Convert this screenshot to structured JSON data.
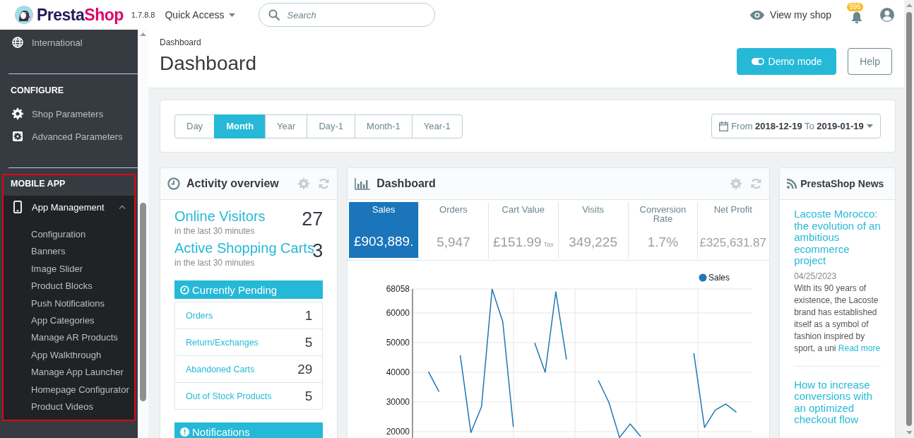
{
  "header": {
    "brand": {
      "first": "Presta",
      "second": "Shop"
    },
    "version": "1.7.8.8",
    "quick_access": "Quick Access",
    "search": {
      "placeholder": "Search"
    },
    "view_shop": "View my shop",
    "notification_count": "996"
  },
  "sidebar": {
    "groups": [
      {
        "items": [
          {
            "label": "International",
            "selected": false
          }
        ]
      },
      {
        "heading": "CONFIGURE",
        "items": [
          {
            "label": "Shop Parameters",
            "selected": false
          },
          {
            "label": "Advanced Parameters",
            "selected": false
          }
        ]
      },
      {
        "heading": "MOBILE APP",
        "highlighted": true,
        "items": [
          {
            "label": "App Management",
            "selected": true,
            "expanded": true,
            "children": [
              {
                "label": "Configuration",
                "selected": false
              },
              {
                "label": "Banners",
                "selected": false
              },
              {
                "label": "Image Slider",
                "selected": false
              },
              {
                "label": "Product Blocks",
                "selected": false
              },
              {
                "label": "Push Notifications",
                "selected": false
              },
              {
                "label": "App Categories",
                "selected": false
              },
              {
                "label": "Manage AR Products",
                "selected": false
              },
              {
                "label": "App Walkthrough",
                "selected": false
              },
              {
                "label": "Manage App Launcher",
                "selected": false
              },
              {
                "label": "Homepage Configurator",
                "selected": false
              },
              {
                "label": "Product Videos",
                "selected": false
              }
            ]
          }
        ]
      }
    ]
  },
  "page": {
    "breadcrumb": "Dashboard",
    "title": "Dashboard",
    "buttons": [
      {
        "kind": "demo",
        "label": "Demo mode"
      },
      {
        "kind": "outline",
        "label": "Help"
      }
    ]
  },
  "period_tabs": [
    {
      "label": "Day",
      "selected": false
    },
    {
      "label": "Month",
      "selected": true
    },
    {
      "label": "Year",
      "selected": false
    },
    {
      "label": "Day-1",
      "selected": false
    },
    {
      "label": "Month-1",
      "selected": false
    },
    {
      "label": "Year-1",
      "selected": false
    }
  ],
  "date_range": "From **2018-12-19** To **2019-01-19**",
  "activity": {
    "title": "Activity overview",
    "stats": [
      {
        "label": "Online Visitors",
        "subtitle": "in the last 30 minutes",
        "value": "27"
      },
      {
        "label": "Active Shopping Carts",
        "subtitle": "in the last 30 minutes",
        "value": "3"
      }
    ],
    "pending_heading": "Currently Pending",
    "pending": [
      {
        "label": "Orders",
        "value": "1"
      },
      {
        "label": "Return/Exchanges",
        "value": "5"
      },
      {
        "label": "Abandoned Carts",
        "value": "29"
      },
      {
        "label": "Out of Stock Products",
        "value": "5"
      }
    ],
    "notifications_heading": "Notifications"
  },
  "dashboard": {
    "title": "Dashboard",
    "kpis": [
      {
        "label": "Sales",
        "value": "£903,889.",
        "selected": true
      },
      {
        "label": "Orders",
        "value": "5,947",
        "selected": false
      },
      {
        "label": "Cart Value",
        "value": "£151.99",
        "suffix": "Tax",
        "selected": false
      },
      {
        "label": "Visits",
        "value": "349,225",
        "selected": false
      },
      {
        "label": "Conversion Rate",
        "value": "1.7%",
        "selected": false
      },
      {
        "label": "Net Profit",
        "value": "£325,631.87",
        "selected": false
      }
    ],
    "chart_data": {
      "type": "line",
      "grid": true,
      "categories": [
        null,
        null,
        null,
        null,
        null,
        null,
        null,
        null,
        null,
        null,
        null,
        null,
        null,
        null,
        null,
        null,
        null,
        null,
        null,
        null,
        null,
        null,
        null,
        null,
        null,
        null,
        null,
        null,
        null,
        null,
        null,
        null
      ],
      "ylim": [
        0,
        68058
      ],
      "yticks": [
        20000,
        30000,
        40000,
        50000,
        60000,
        68058
      ],
      "series": [
        {
          "name": "Sales",
          "color": "#1f77b4",
          "values": [
            null,
            40200,
            33400,
            null,
            45700,
            19700,
            28400,
            68000,
            57000,
            21600,
            null,
            49900,
            40000,
            67100,
            44300,
            null,
            null,
            37300,
            29800,
            18000,
            22600,
            18300,
            null,
            null,
            null,
            null,
            46400,
            21400,
            27200,
            29300,
            26600,
            null
          ]
        }
      ]
    }
  },
  "news": {
    "title": "PrestaShop News",
    "articles": [
      {
        "title": "Lacoste Morocco: the evolution of an ambitious ecommerce project",
        "date": "04/25/2023",
        "excerpt": "With its 90 years of existence, the Lacoste brand has established itself as a symbol of fashion inspired by sport, a uni",
        "read_more": "Read more"
      },
      {
        "title": "How to increase conversions with an optimized checkout flow"
      }
    ]
  }
}
